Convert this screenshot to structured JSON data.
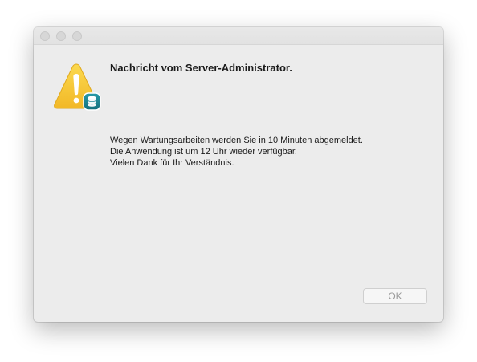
{
  "dialog": {
    "title": "Nachricht vom Server-Administrator.",
    "message_lines": [
      "Wegen Wartungsarbeiten werden Sie in 10 Minuten abgemeldet.",
      "Die Anwendung ist um 12 Uhr wieder verfügbar.",
      "Vielen Dank für Ihr Verständnis."
    ],
    "ok_label": "OK",
    "icon": "warning-triangle-icon",
    "badge_icon": "database-server-icon"
  },
  "colors": {
    "warning_yellow": "#f7c948",
    "badge_teal": "#1f8a98",
    "window_bg": "#ececec"
  }
}
